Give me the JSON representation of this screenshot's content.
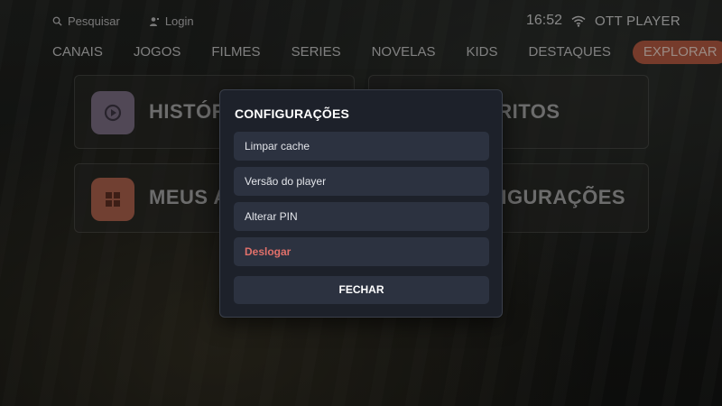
{
  "topbar": {
    "search_label": "Pesquisar",
    "login_label": "Login",
    "time": "16:52",
    "brand": "OTT PLAYER"
  },
  "nav": {
    "items": [
      "CANAIS",
      "JOGOS",
      "FILMES",
      "SERIES",
      "NOVELAS",
      "KIDS",
      "DESTAQUES",
      "EXPLORAR"
    ],
    "active": "EXPLORAR"
  },
  "tiles": [
    {
      "label": "HISTÓRICO",
      "icon": "history-icon",
      "color": "#7c6f85"
    },
    {
      "label": "FAVORITOS",
      "icon": "favorite-icon",
      "color": "#7a7d4a"
    },
    {
      "label": "MEUS APPS",
      "icon": "apps-grid-icon",
      "color": "#c46a52"
    },
    {
      "label": "CONFIGURAÇÕES",
      "icon": "settings-icon",
      "color": "#5a5f6a"
    }
  ],
  "modal": {
    "title": "CONFIGURAÇÕES",
    "options": [
      "Limpar cache",
      "Versão do player",
      "Alterar PIN",
      "Deslogar"
    ],
    "close_label": "FECHAR"
  },
  "colors": {
    "accent": "#b8593f",
    "danger": "#e0706a",
    "modal_bg": "#1d212a",
    "option_bg": "#2c3240"
  }
}
